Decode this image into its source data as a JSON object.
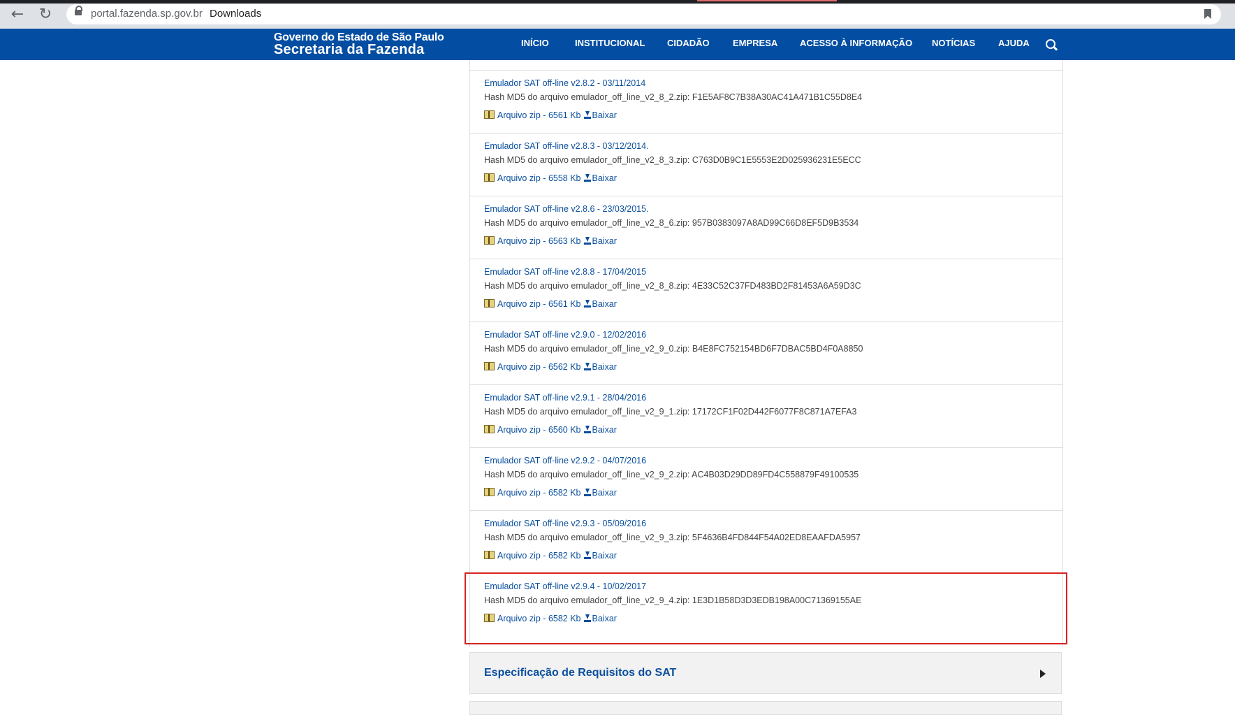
{
  "browser": {
    "url_host": "portal.fazenda.sp.gov.br",
    "page_title": "Downloads",
    "back_icon": "←",
    "reload_icon": "↻"
  },
  "header": {
    "brand_line1": "Governo do Estado de São Paulo",
    "brand_line2": "Secretaria da Fazenda",
    "menu": [
      "INÍCIO",
      "INSTITUCIONAL",
      "CIDADÃO",
      "EMPRESA",
      "ACESSO À INFORMAÇÃO",
      "NOTÍCIAS",
      "AJUDA"
    ]
  },
  "downloads": [
    {
      "title": "Emulador SAT off-line v2.8.2 - 03/11/2014",
      "hash": "Hash MD5 do arquivo emulador_off_line_v2_8_2.zip: F1E5AF8C7B38A30AC41A471B1C55D8E4",
      "file": "Arquivo zip - 6561 Kb",
      "download": "Baixar"
    },
    {
      "title": "Emulador SAT off-line v2.8.3 - 03/12/2014.",
      "hash": "Hash MD5 do arquivo emulador_off_line_v2_8_3.zip: C763D0B9C1E5553E2D025936231E5ECC",
      "file": "Arquivo zip - 6558 Kb",
      "download": "Baixar"
    },
    {
      "title": "Emulador SAT off-line v2.8.6 - 23/03/2015.",
      "hash": "Hash MD5 do arquivo emulador_off_line_v2_8_6.zip: 957B0383097A8AD99C66D8EF5D9B3534",
      "file": "Arquivo zip - 6563 Kb",
      "download": "Baixar"
    },
    {
      "title": "Emulador SAT off-line v2.8.8 - 17/04/2015",
      "hash": "Hash MD5 do arquivo emulador_off_line_v2_8_8.zip: 4E33C52C37FD483BD2F81453A6A59D3C",
      "file": "Arquivo zip - 6561 Kb",
      "download": "Baixar"
    },
    {
      "title": "Emulador SAT off-line v2.9.0 - 12/02/2016",
      "hash": "Hash MD5 do arquivo emulador_off_line_v2_9_0.zip: B4E8FC752154BD6F7DBAC5BD4F0A8850",
      "file": "Arquivo zip - 6562 Kb",
      "download": "Baixar"
    },
    {
      "title": "Emulador SAT off-line v2.9.1 - 28/04/2016",
      "hash": "Hash MD5 do arquivo emulador_off_line_v2_9_1.zip: 17172CF1F02D442F6077F8C871A7EFA3",
      "file": "Arquivo zip - 6560 Kb",
      "download": "Baixar"
    },
    {
      "title": "Emulador SAT off-line v2.9.2 - 04/07/2016",
      "hash": "Hash MD5 do arquivo emulador_off_line_v2_9_2.zip: AC4B03D29DD89FD4C558879F49100535",
      "file": "Arquivo zip - 6582 Kb",
      "download": "Baixar"
    },
    {
      "title": "Emulador SAT off-line v2.9.3 - 05/09/2016",
      "hash": "Hash MD5 do arquivo emulador_off_line_v2_9_3.zip: 5F4636B4FD844F54A02ED8EAAFDA5957",
      "file": "Arquivo zip - 6582 Kb",
      "download": "Baixar"
    },
    {
      "title": "Emulador SAT off-line v2.9.4 - 10/02/2017",
      "hash": "Hash MD5 do arquivo emulador_off_line_v2_9_4.zip: 1E3D1B58D3D3EDB198A00C71369155AE",
      "file": "Arquivo zip - 6582 Kb",
      "download": "Baixar"
    }
  ],
  "accordion": {
    "title": "Especificação de Requisitos do SAT"
  },
  "colors": {
    "header_blue": "#034ea2",
    "link_blue": "#0a4f9e",
    "highlight_red": "#d62323"
  }
}
